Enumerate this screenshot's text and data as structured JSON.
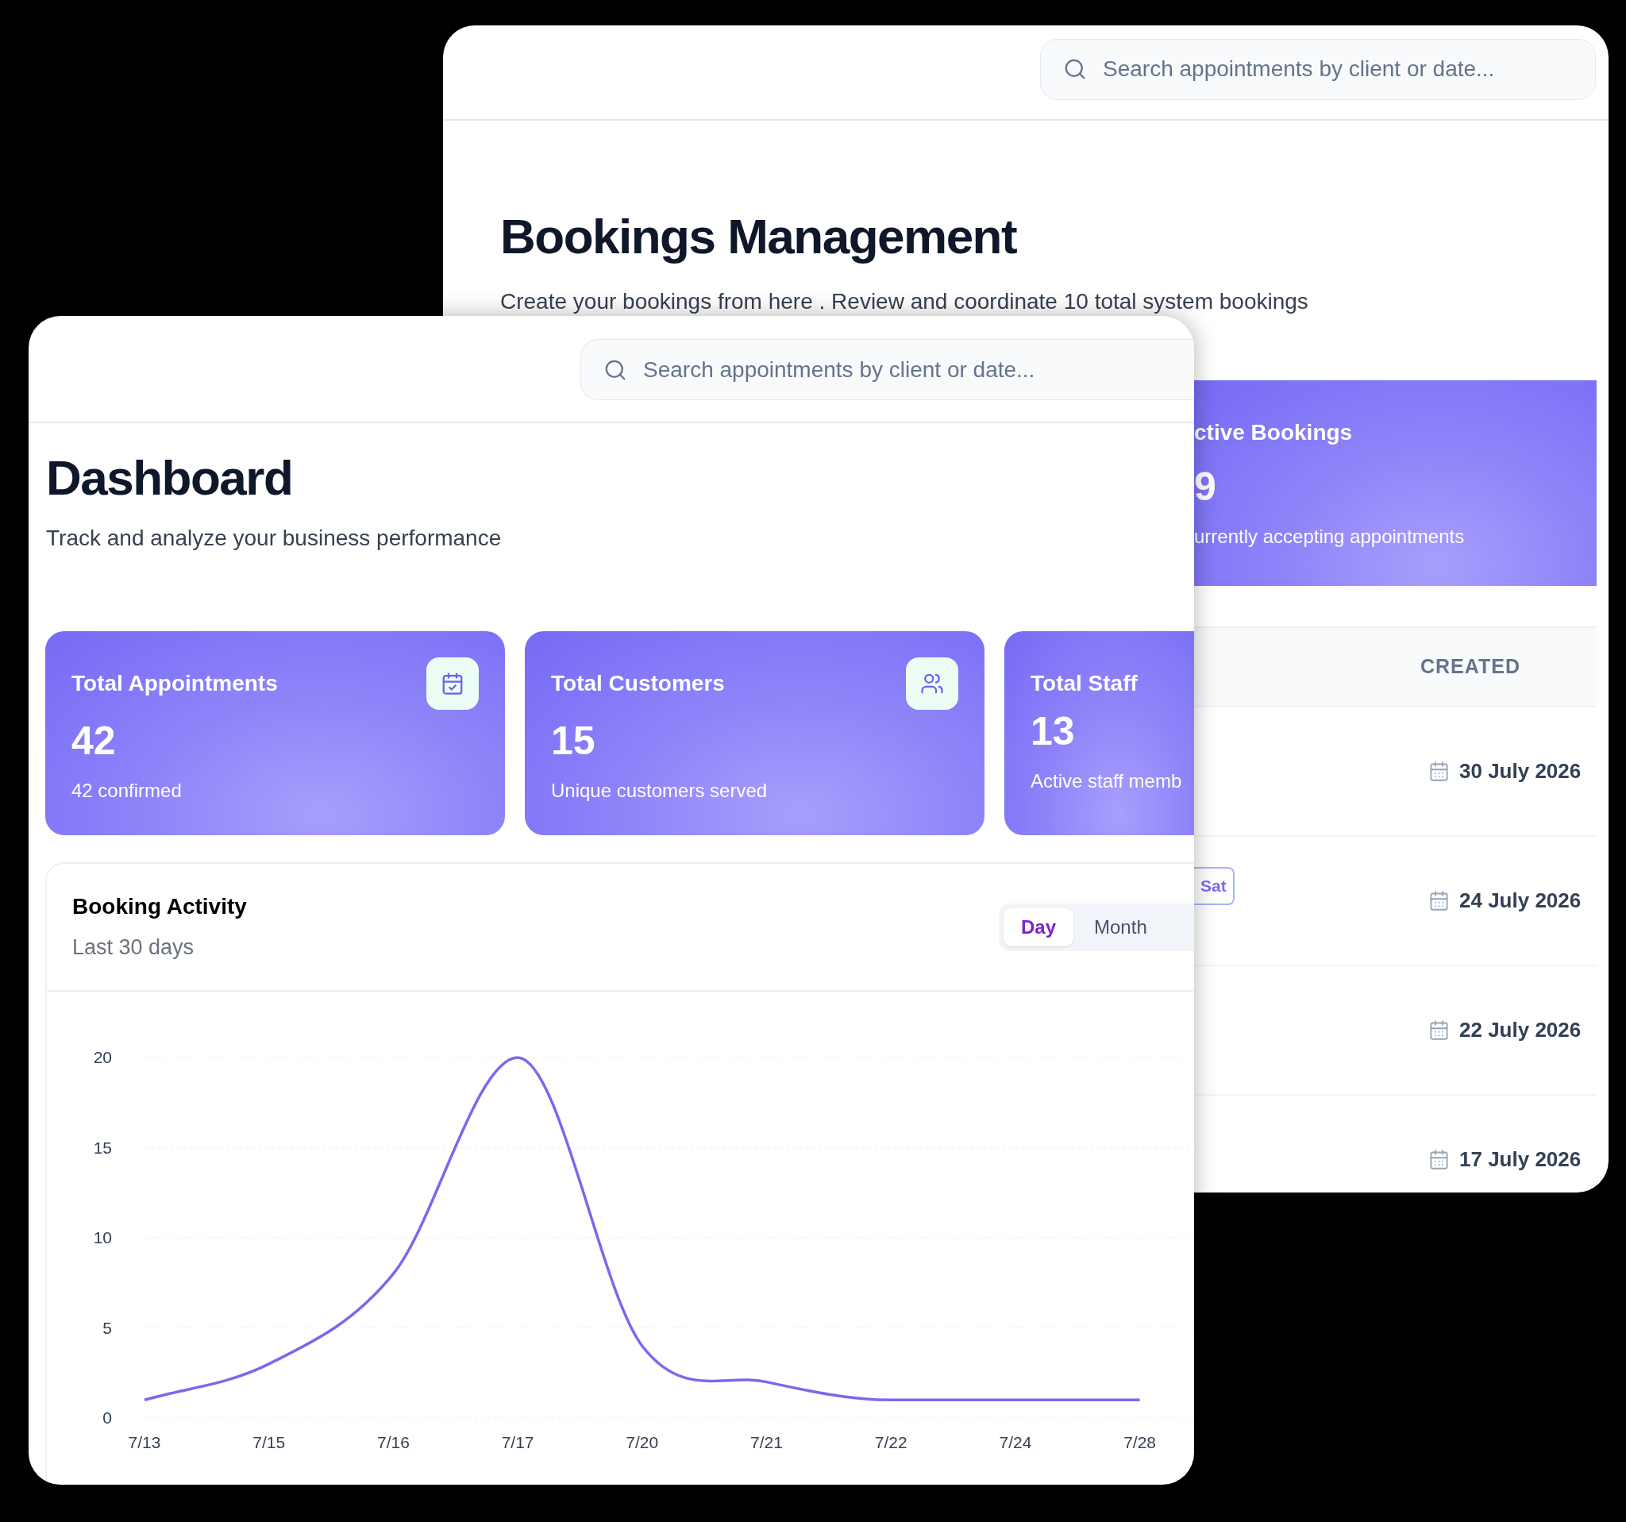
{
  "back_window": {
    "search": {
      "placeholder": "Search appointments by client or date..."
    },
    "title": "Bookings Management",
    "subtitle": "Create your bookings from here . Review and coordinate 10 total system bookings",
    "stat_card": {
      "title": "ctive Bookings",
      "value": "9",
      "caption": "urrently accepting appointments"
    },
    "table": {
      "columns": [
        "CREATED"
      ],
      "rows": [
        {
          "created": "30 July 2026"
        },
        {
          "tag": "Sat",
          "created": "24 July 2026"
        },
        {
          "created": "22 July 2026"
        },
        {
          "created": "17 July 2026"
        }
      ]
    }
  },
  "front_window": {
    "search": {
      "placeholder": "Search appointments by client or date..."
    },
    "title": "Dashboard",
    "subtitle": "Track and analyze your business performance",
    "stat_cards": [
      {
        "title": "Total Appointments",
        "value": "42",
        "caption": "42 confirmed"
      },
      {
        "title": "Total Customers",
        "value": "15",
        "caption": "Unique customers served"
      },
      {
        "title": "Total Staff",
        "value": "13",
        "caption": "Active staff memb"
      }
    ],
    "activity": {
      "title": "Booking Activity",
      "subtitle": "Last 30 days",
      "ranges": [
        {
          "label": "Day",
          "selected": true
        },
        {
          "label": "Month",
          "selected": false
        }
      ],
      "chart_data": {
        "type": "line",
        "categories": [
          "7/13",
          "7/15",
          "7/16",
          "7/17",
          "7/20",
          "7/21",
          "7/22",
          "7/24",
          "7/28"
        ],
        "series": [
          {
            "color": "#7b68ee",
            "values": [
              1,
              3,
              8,
              20,
              4,
              2,
              1,
              1,
              1
            ]
          }
        ],
        "ylim": [
          0,
          20
        ],
        "yticks": [
          0,
          5,
          10,
          15,
          20
        ],
        "grid": true
      }
    }
  }
}
